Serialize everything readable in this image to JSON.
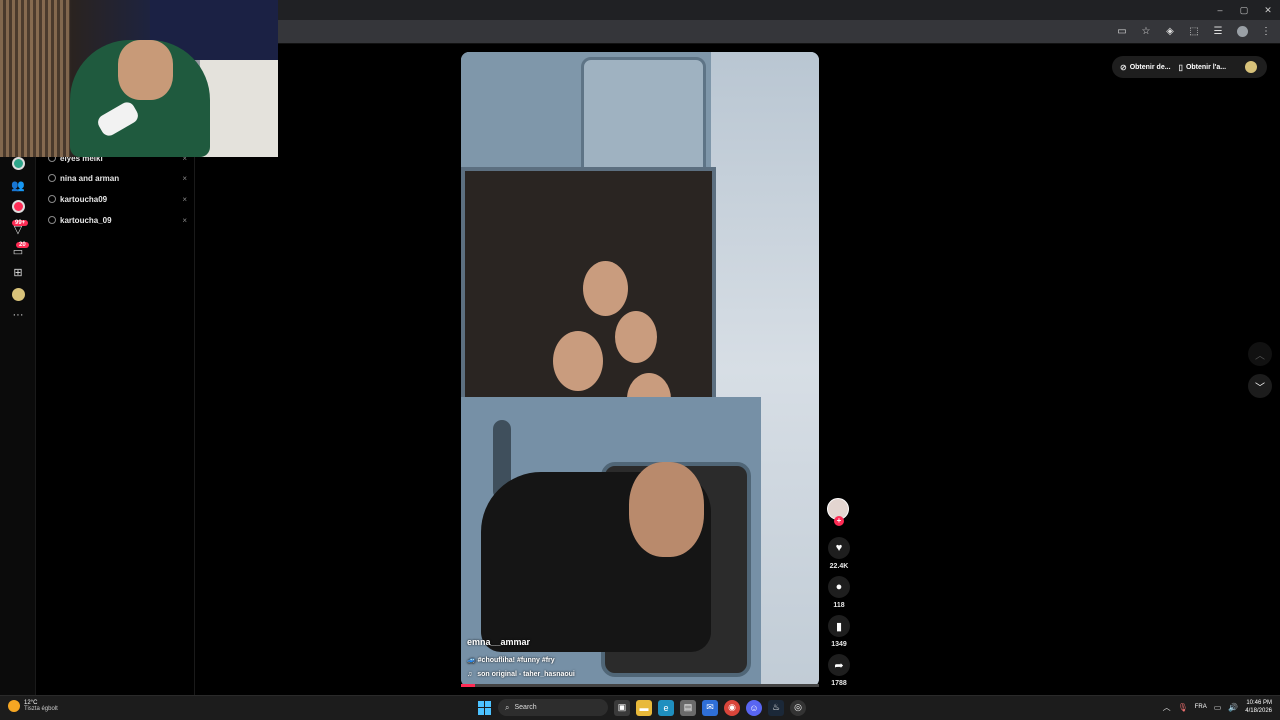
{
  "browser": {
    "window_controls": [
      "–",
      "▢",
      "✕"
    ]
  },
  "sidebar": {
    "items": [
      {
        "icon": "foryou-icon"
      },
      {
        "icon": "friends-icon"
      },
      {
        "icon": "live-icon"
      },
      {
        "icon": "activity-icon",
        "badge": "99+"
      },
      {
        "icon": "messages-icon",
        "badge": "20"
      },
      {
        "icon": "upload-icon"
      },
      {
        "icon": "profile-icon"
      },
      {
        "icon": "more-icon"
      }
    ]
  },
  "search_history": {
    "items": [
      {
        "label": "elyes melki"
      },
      {
        "label": "nina and arman"
      },
      {
        "label": "kartoucha09"
      },
      {
        "label": "kartoucha_09"
      }
    ],
    "remove_glyph": "×"
  },
  "video": {
    "author": "emna__ammar",
    "hashtags": "🚙 #choufliha! #funny #fry",
    "sound": "son original - taher_hasnaoui",
    "progress": 0.04
  },
  "actions": {
    "likes": "22.4K",
    "comments": "118",
    "saves": "1349",
    "shares": "1788"
  },
  "header": {
    "get_coins": "Obtenir de...",
    "get_app": "Obtenir l'a..."
  },
  "taskbar": {
    "temperature": "12°C",
    "weather_desc": "Tiszta égbolt",
    "search_placeholder": "Search",
    "language": "FRA",
    "time": "10:46 PM",
    "date": "4/18/2026"
  },
  "colors": {
    "accent": "#fe2c55",
    "background": "#000000"
  }
}
